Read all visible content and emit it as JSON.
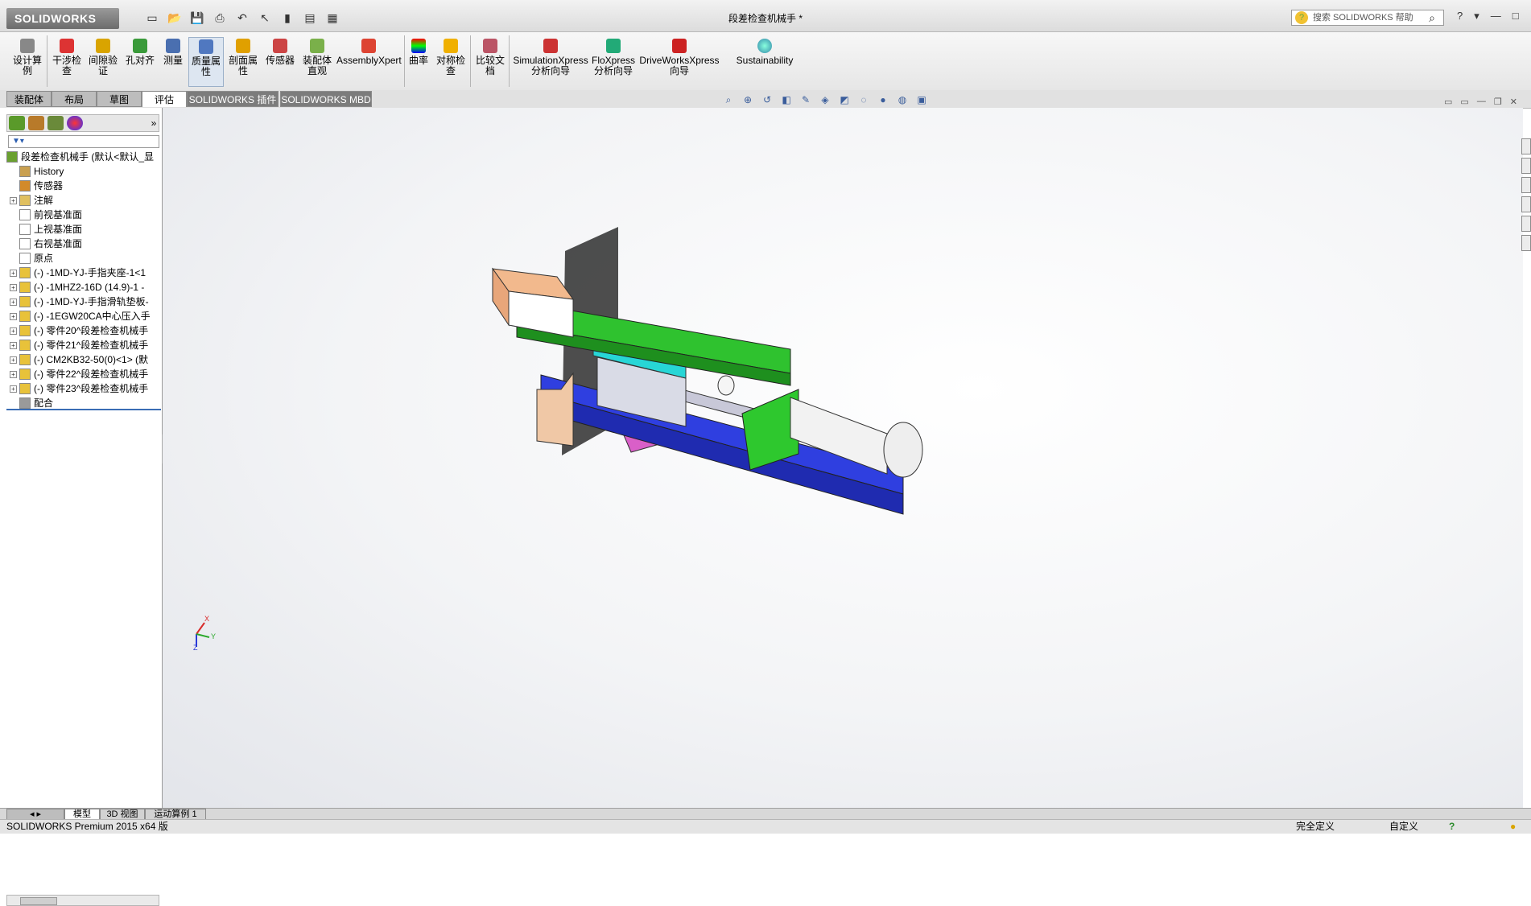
{
  "app": {
    "logo_text": "SOLIDWORKS",
    "doc_title": "段差检查机械手 *"
  },
  "search": {
    "placeholder": "搜索 SOLIDWORKS 帮助"
  },
  "window_controls": [
    "?",
    "▾",
    "—",
    "□",
    "✕"
  ],
  "ribbon": {
    "buttons": [
      {
        "label": "设计算\n例",
        "icon": "design-study-icon"
      },
      {
        "label": "干涉检\n查",
        "icon": "interference-icon"
      },
      {
        "label": "间隙验\n证",
        "icon": "clearance-icon"
      },
      {
        "label": "孔对齐",
        "icon": "hole-align-icon"
      },
      {
        "label": "测量",
        "icon": "measure-icon"
      },
      {
        "label": "质量属\n性",
        "icon": "mass-props-icon"
      },
      {
        "label": "剖面属\n性",
        "icon": "section-props-icon"
      },
      {
        "label": "传感器",
        "icon": "sensor-icon"
      },
      {
        "label": "装配体\n直观",
        "icon": "assembly-visual-icon"
      },
      {
        "label": "AssemblyXpert",
        "icon": "assemblyxpert-icon"
      },
      {
        "label": "曲率",
        "icon": "curvature-icon"
      },
      {
        "label": "对称检\n查",
        "icon": "symmetry-icon"
      },
      {
        "label": "比较文\n档",
        "icon": "compare-icon"
      },
      {
        "label": "SimulationXpress\n分析向导",
        "icon": "simulation-icon"
      },
      {
        "label": "FloXpress\n分析向导",
        "icon": "floxpress-icon"
      },
      {
        "label": "DriveWorksXpress\n向导",
        "icon": "driveworks-icon"
      },
      {
        "label": "Sustainability",
        "icon": "sustainability-icon"
      }
    ]
  },
  "tabs": [
    "装配体",
    "布局",
    "草图",
    "评估",
    "SOLIDWORKS 插件",
    "SOLIDWORKS MBD"
  ],
  "feature_tree": {
    "filter_icon": "filter-icon",
    "items": [
      {
        "text": "段差检查机械手  (默认<默认_显",
        "icon": "assembly-icon",
        "expand": false,
        "indent": 0
      },
      {
        "text": "History",
        "icon": "history-icon",
        "expand": false,
        "indent": 1
      },
      {
        "text": "传感器",
        "icon": "sensor-icon",
        "expand": false,
        "indent": 1
      },
      {
        "text": "注解",
        "icon": "annotation-icon",
        "expand": true,
        "indent": 1
      },
      {
        "text": "前视基准面",
        "icon": "plane-icon",
        "expand": false,
        "indent": 1
      },
      {
        "text": "上视基准面",
        "icon": "plane-icon",
        "expand": false,
        "indent": 1
      },
      {
        "text": "右视基准面",
        "icon": "plane-icon",
        "expand": false,
        "indent": 1
      },
      {
        "text": "原点",
        "icon": "origin-icon",
        "expand": false,
        "indent": 1
      },
      {
        "text": "(-) -1MD-YJ-手指夹座-1<1",
        "icon": "part-icon",
        "expand": true,
        "indent": 1
      },
      {
        "text": "(-) -1MHZ2-16D (14.9)-1 -",
        "icon": "part-icon",
        "expand": true,
        "indent": 1
      },
      {
        "text": "(-) -1MD-YJ-手指滑轨垫板-",
        "icon": "part-icon",
        "expand": true,
        "indent": 1
      },
      {
        "text": "(-) -1EGW20CA中心压入手",
        "icon": "part-icon",
        "expand": true,
        "indent": 1
      },
      {
        "text": "(-) 零件20^段差检查机械手",
        "icon": "part-icon",
        "expand": true,
        "indent": 1
      },
      {
        "text": "(-) 零件21^段差检查机械手",
        "icon": "part-icon",
        "expand": true,
        "indent": 1
      },
      {
        "text": "(-) CM2KB32-50(0)<1> (默",
        "icon": "part-icon",
        "expand": true,
        "indent": 1
      },
      {
        "text": "(-) 零件22^段差检查机械手",
        "icon": "part-icon",
        "expand": true,
        "indent": 1
      },
      {
        "text": "(-) 零件23^段差检查机械手",
        "icon": "part-icon",
        "expand": true,
        "indent": 1
      },
      {
        "text": "配合",
        "icon": "mates-icon",
        "expand": false,
        "indent": 1
      }
    ]
  },
  "bottom_tabs": [
    "模型",
    "3D 视图",
    "运动算例 1"
  ],
  "status": {
    "left": "SOLIDWORKS Premium 2015 x64 版",
    "defined": "完全定义",
    "custom": "自定义"
  },
  "triad": {
    "x": "X",
    "y": "Y",
    "z": "Z"
  }
}
